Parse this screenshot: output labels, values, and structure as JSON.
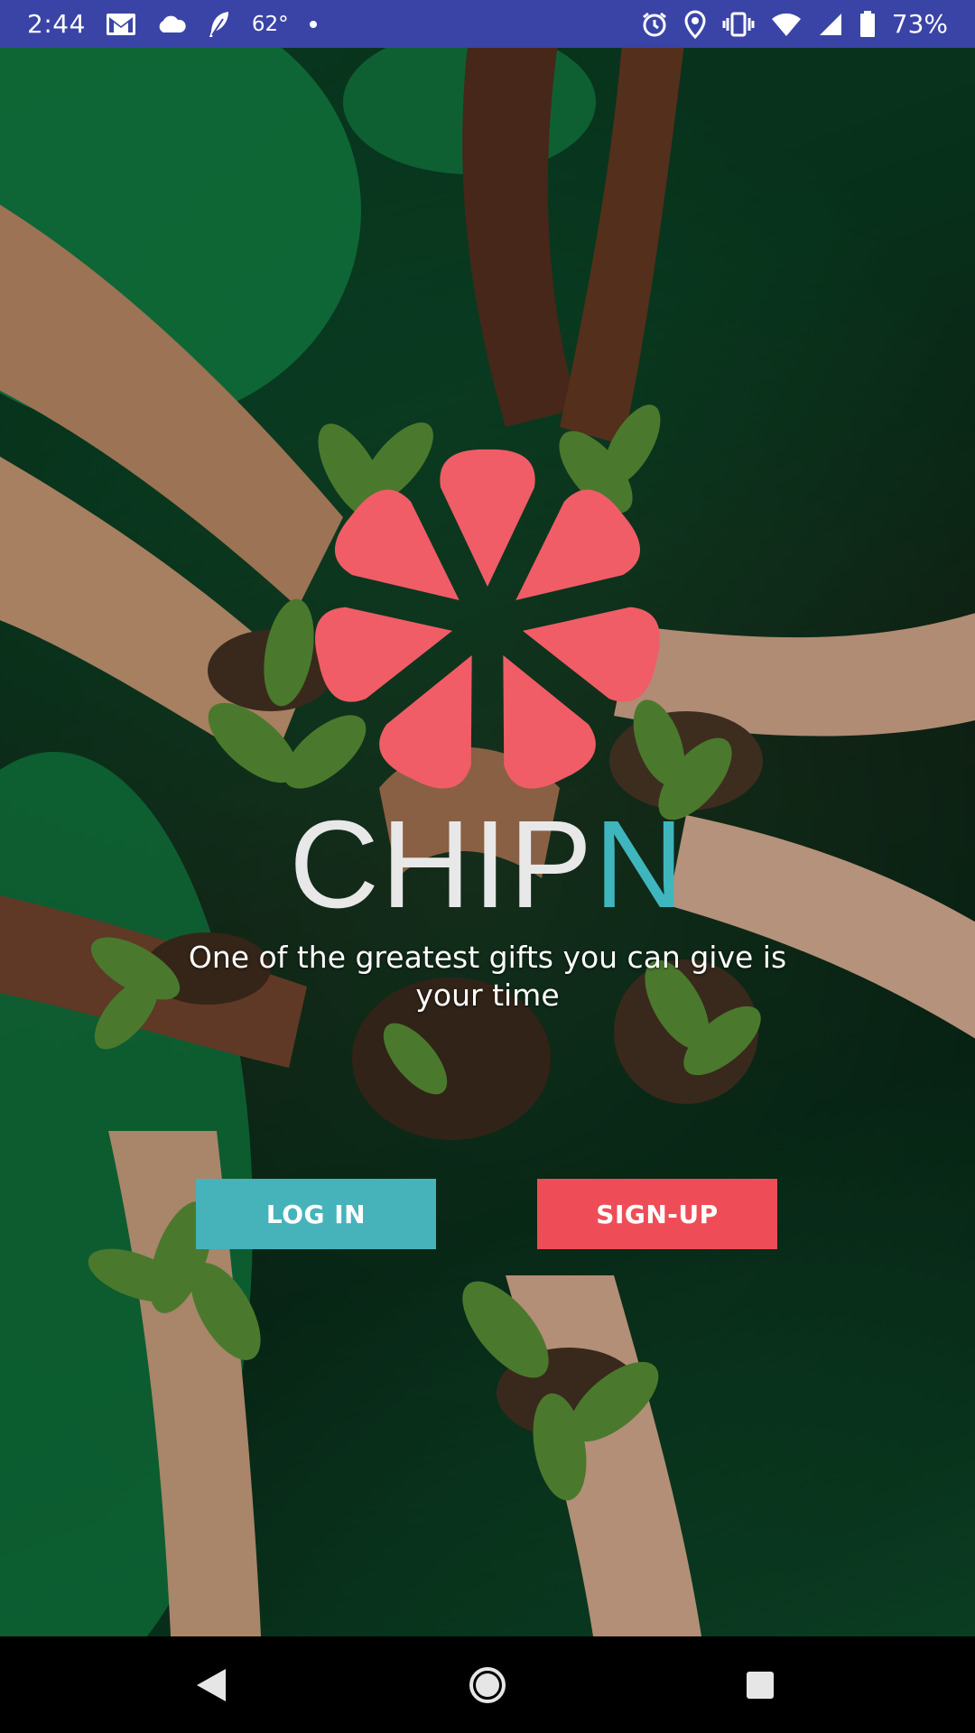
{
  "status_bar": {
    "time": "2:44",
    "temperature": "62°",
    "battery": "73%",
    "left_icons": [
      "gmail-icon",
      "cloud-icon",
      "feather-icon",
      "dot-icon"
    ],
    "right_icons": [
      "alarm-icon",
      "location-icon",
      "vibrate-icon",
      "wifi-icon",
      "signal-icon",
      "battery-icon"
    ]
  },
  "logo": {
    "wordmark_main": "CHIP",
    "wordmark_accent": "N",
    "petal_color": "#f05d67",
    "wordmark_color": "#e8e8e8",
    "accent_color": "#3fb6bd"
  },
  "tagline": "One of the greatest gifts you can give is your time",
  "buttons": {
    "login_label": "LOG IN",
    "signup_label": "SIGN-UP",
    "login_color": "#46b3bb",
    "signup_color": "#ee4d58"
  },
  "nav_bar": {
    "icons": [
      "back-icon",
      "home-icon",
      "recents-icon"
    ]
  }
}
